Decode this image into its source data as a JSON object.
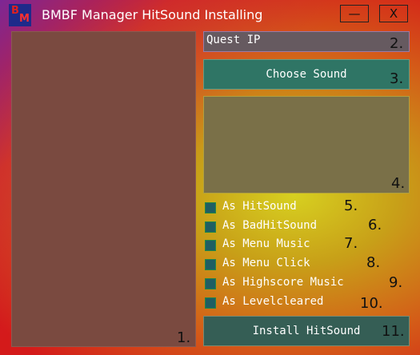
{
  "window": {
    "title": "BMBF Manager HitSound Installing",
    "logo_letters": [
      "B",
      "M"
    ],
    "minimize_label": "—",
    "close_label": "X"
  },
  "left_panel": {
    "number": "1."
  },
  "quest_ip": {
    "value": "Quest IP",
    "number": "2."
  },
  "choose_sound": {
    "label": "Choose Sound",
    "number": "3."
  },
  "sound_box": {
    "number": "4."
  },
  "options": [
    {
      "label": "As HitSound",
      "number": "5."
    },
    {
      "label": "As BadHitSound",
      "number": "6."
    },
    {
      "label": "As Menu Music",
      "number": "7."
    },
    {
      "label": "As Menu Click",
      "number": "8."
    },
    {
      "label": "As Highscore Music",
      "number": "9."
    },
    {
      "label": "As Levelcleared",
      "number": "10."
    }
  ],
  "install": {
    "label": "Install HitSound",
    "number": "11."
  },
  "colors": {
    "button_bg": "#2f7565",
    "checkbox_bg": "#1f5e63",
    "panel_bg": "#7a4a40"
  }
}
